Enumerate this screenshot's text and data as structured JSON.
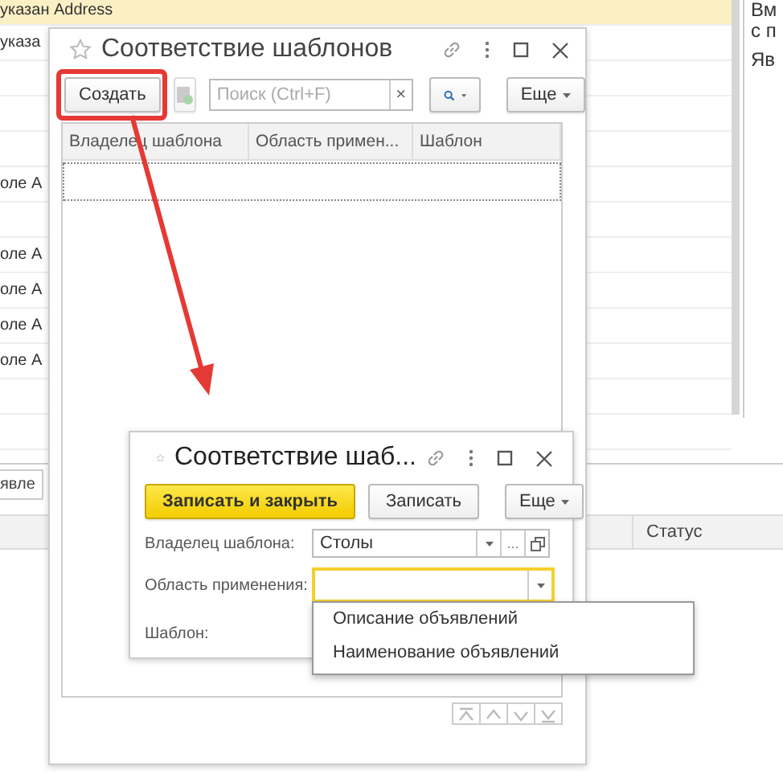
{
  "background_list": {
    "rows": [
      {
        "text": "указан Address",
        "selected": true
      },
      {
        "text": "указа",
        "selected": false
      },
      {
        "selected": false
      },
      {
        "selected": false
      },
      {
        "selected": false
      },
      {
        "text": "оле A",
        "selected": false
      },
      {
        "selected": false
      },
      {
        "text": "оле A",
        "selected": false
      },
      {
        "text": "оле A",
        "selected": false
      },
      {
        "text": "оле A",
        "selected": false
      },
      {
        "text": "оле A",
        "selected": false
      },
      {
        "selected": false
      }
    ]
  },
  "side_panel": {
    "lines": [
      "Вм",
      "с п",
      "Яв"
    ]
  },
  "bottom_panel": {
    "tab": "явле",
    "columns": [
      "Статус"
    ]
  },
  "list_window": {
    "title": "Соответствие шаблонов",
    "toolbar": {
      "create_button": {
        "label": "Создать",
        "highlighted": true
      },
      "copy_button": {
        "disabled": true
      },
      "search": {
        "placeholder": "Поиск (Ctrl+F)",
        "clear": "×"
      },
      "more_button": "Еще"
    },
    "table": {
      "columns": [
        "Владелец шаблона",
        "Область примен...",
        "Шаблон"
      ]
    }
  },
  "form_window": {
    "title": "Соответствие шаб...",
    "buttons": [
      {
        "label": "Записать и закрыть",
        "kind": "primary"
      },
      {
        "label": "Записать",
        "kind": "default"
      },
      {
        "label": "Еще",
        "kind": "menu"
      }
    ],
    "fields": [
      {
        "label": "Владелец шаблона:",
        "value": "Столы",
        "choose_button": "...",
        "kind": "reference",
        "focused": false
      },
      {
        "label": "Область применения:",
        "kind": "select",
        "focused": true
      },
      {
        "label": "Шаблон:",
        "kind": "covered",
        "focused": false
      }
    ]
  },
  "dropdown": {
    "items": [
      "Описание объявлений",
      "Наименование объявлений"
    ]
  }
}
